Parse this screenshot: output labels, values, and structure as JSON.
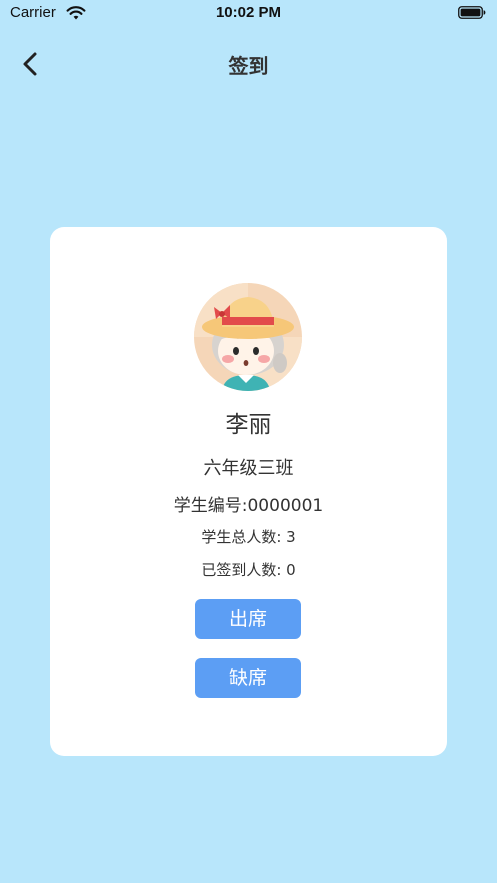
{
  "status_bar": {
    "carrier": "Carrier",
    "time": "10:02 PM",
    "wifi_icon": "wifi-icon",
    "battery_icon": "battery-icon"
  },
  "nav": {
    "title": "签到",
    "back_icon": "chevron-left-icon"
  },
  "student": {
    "avatar_icon": "cartoon-girl-avatar",
    "name": "李丽",
    "class_name": "六年级三班",
    "student_number": "学生编号:0000001",
    "total_students": "学生总人数: 3",
    "signed_in_count": "已签到人数: 0"
  },
  "actions": {
    "present_label": "出席",
    "absent_label": "缺席"
  },
  "colors": {
    "background": "#b8e6fb",
    "card": "#ffffff",
    "button": "#5c9ef4",
    "text": "#333333"
  }
}
